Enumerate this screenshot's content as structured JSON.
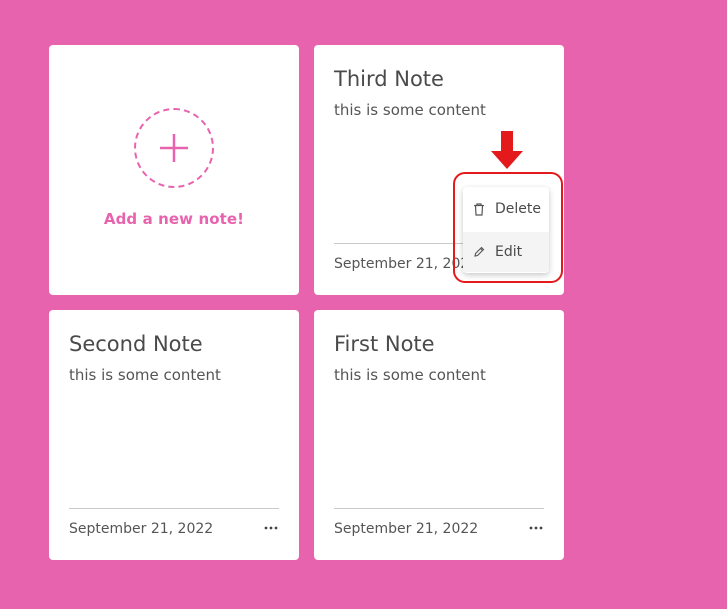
{
  "colors": {
    "background": "#e863ae",
    "accent": "#e863ae",
    "annotation": "#e3191c"
  },
  "add_card": {
    "label": "Add a new note!",
    "icon": "plus-icon"
  },
  "notes": [
    {
      "title": "Third Note",
      "content": "this is some content",
      "date": "September 21, 2022"
    },
    {
      "title": "Second Note",
      "content": "this is some content",
      "date": "September 21, 2022"
    },
    {
      "title": "First Note",
      "content": "this is some content",
      "date": "September 21, 2022"
    }
  ],
  "dropdown_menu": {
    "items": [
      {
        "label": "Delete",
        "icon": "trash-icon"
      },
      {
        "label": "Edit",
        "icon": "pencil-icon"
      }
    ]
  },
  "annotation": {
    "arrow_icon": "down-arrow-icon",
    "box": "highlight-box"
  }
}
